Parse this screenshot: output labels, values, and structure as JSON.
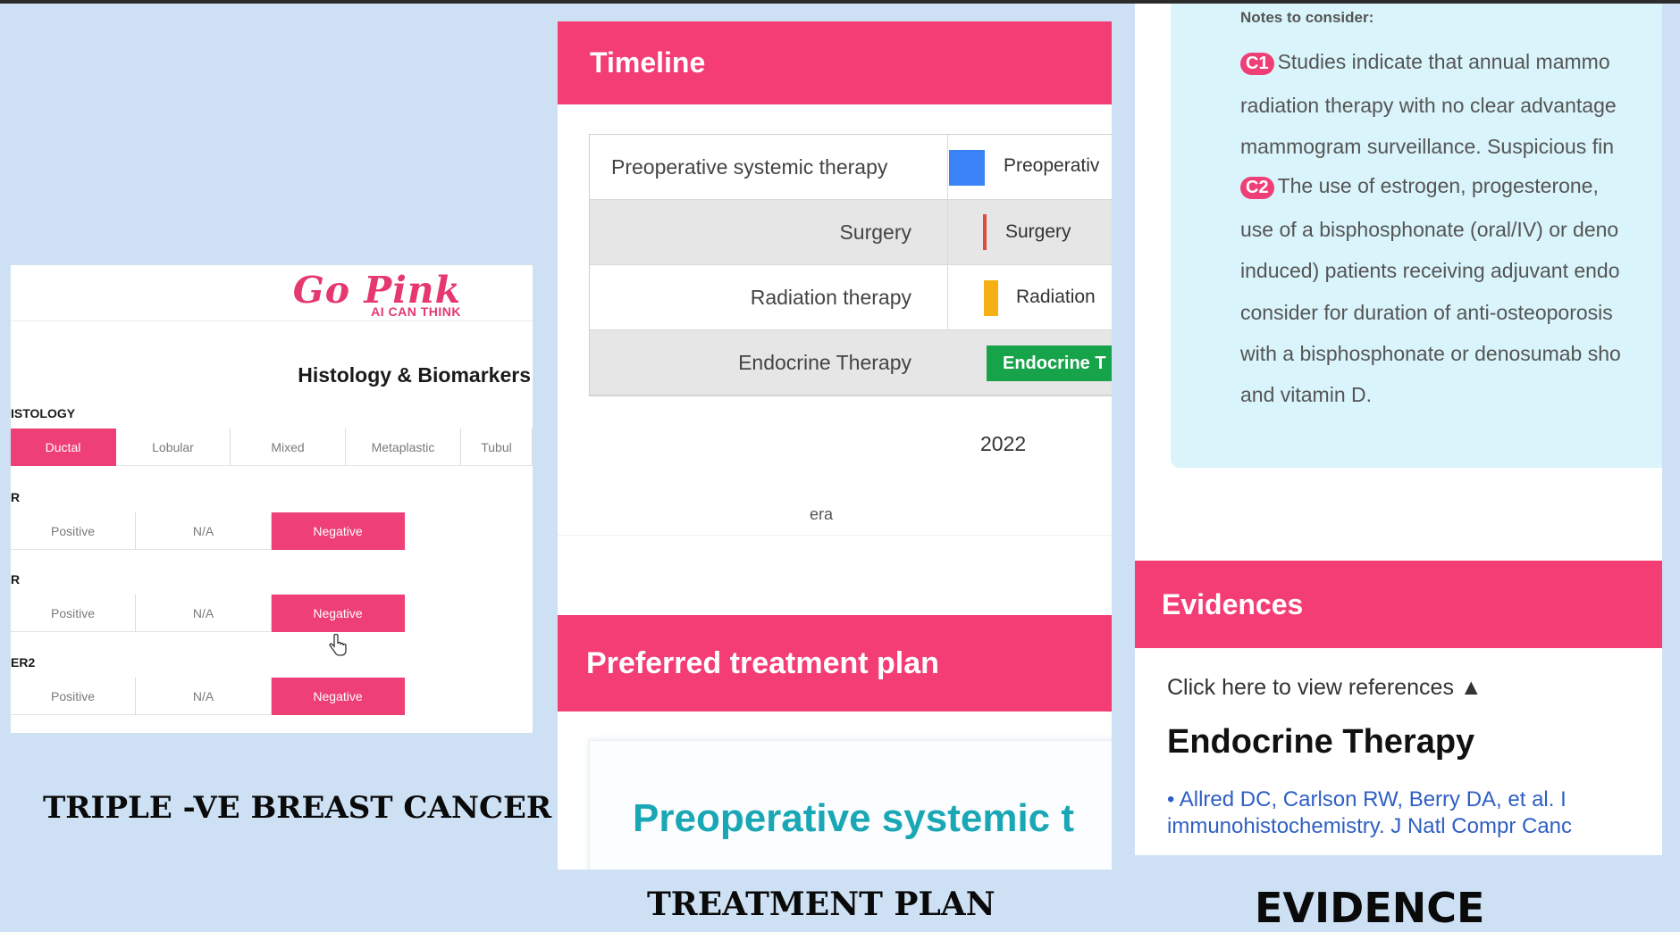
{
  "histology_panel": {
    "logo_main": "Go Pink",
    "logo_sub": "AI CAN THINK",
    "title": "Histology & Biomarkers",
    "histology_label": "ISTOLOGY",
    "histology_options": [
      "Ductal",
      "Lobular",
      "Mixed",
      "Metaplastic",
      "Tubul"
    ],
    "histology_selected": "Ductal",
    "biomarkers": [
      {
        "label": "R",
        "options": [
          "Positive",
          "N/A",
          "Negative"
        ],
        "selected": "Negative"
      },
      {
        "label": "R",
        "options": [
          "Positive",
          "N/A",
          "Negative"
        ],
        "selected": "Negative"
      },
      {
        "label": "ER2",
        "options": [
          "Positive",
          "N/A",
          "Negative"
        ],
        "selected": "Negative"
      }
    ]
  },
  "captions": {
    "left": "TRIPLE -VE BREAST  CANCER",
    "middle": "TREATMENT  PLAN",
    "right": "EVIDENCE"
  },
  "timeline_panel": {
    "title": "Timeline",
    "rows": [
      {
        "name": "Preoperative systemic therapy",
        "bar_label": "Preoperativ",
        "color": "#3b82f6"
      },
      {
        "name": "Surgery",
        "bar_label": "Surgery",
        "color": "#e2483b"
      },
      {
        "name": "Radiation therapy",
        "bar_label": "Radiation",
        "color": "#f5b014"
      },
      {
        "name": "Endocrine Therapy",
        "bar_label": "Endocrine T",
        "color": "#17a34a"
      }
    ],
    "year": "2022",
    "footer_text": "era",
    "preferred_title": "Preferred treatment plan",
    "preferred_value": "Preoperative systemic t"
  },
  "evidence_panel": {
    "notes_title": "Notes to consider:",
    "note_lines": [
      {
        "badge": "C1",
        "text": "Studies indicate that annual mammo"
      },
      {
        "badge": "",
        "text": "radiation therapy with no clear advantage"
      },
      {
        "badge": "",
        "text": "mammogram surveillance. Suspicious fin"
      },
      {
        "badge": "C2",
        "text": "The use of estrogen, progesterone,"
      },
      {
        "badge": "",
        "text": "use of a bisphosphonate (oral/IV) or deno"
      },
      {
        "badge": "",
        "text": "induced) patients receiving adjuvant endo"
      },
      {
        "badge": "",
        "text": "consider for duration of anti-osteoporosis"
      },
      {
        "badge": "",
        "text": "with a bisphosphonate or denosumab sho"
      },
      {
        "badge": "",
        "text": "and vitamin D."
      }
    ],
    "evidences_title": "Evidences",
    "references_toggle": "Click here to view references ▲",
    "evidence_heading": "Endocrine Therapy",
    "reference_lines": [
      "• Allred DC, Carlson RW, Berry DA, et al. I",
      "immunohistochemistry. J Natl Compr Canc"
    ]
  }
}
